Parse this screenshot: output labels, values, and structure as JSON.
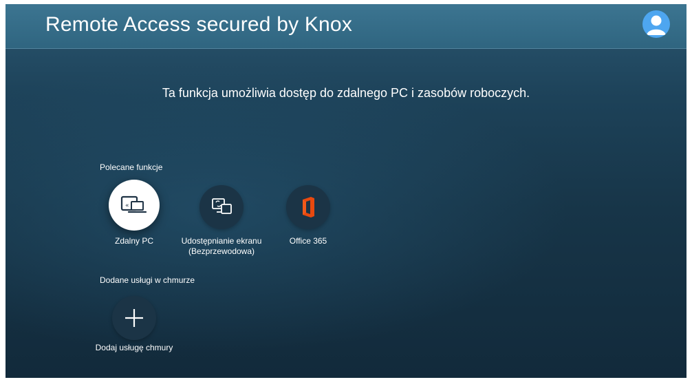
{
  "header": {
    "title": "Remote Access secured by Knox",
    "profile_icon": "user-profile-icon"
  },
  "description": "Ta funkcja umożliwia dostęp do zdalnego PC i zasobów roboczych.",
  "recommended": {
    "label": "Polecane funkcje",
    "items": [
      {
        "label": "Zdalny PC",
        "icon": "remote-pc-icon",
        "focused": true
      },
      {
        "label_line1": "Udostępnianie ekranu",
        "label_line2": "(Bezprzewodowa)",
        "icon": "screen-sharing-icon",
        "focused": false
      },
      {
        "label": "Office 365",
        "icon": "office-365-icon",
        "focused": false
      }
    ]
  },
  "cloud_services": {
    "label": "Dodane usługi w chmurze",
    "add": {
      "label": "Dodaj usługę chmury",
      "icon": "plus-icon"
    }
  },
  "colors": {
    "office_orange": "#e8490f",
    "avatar_blue": "#4ea6f0",
    "topbar": "#3a7290"
  }
}
